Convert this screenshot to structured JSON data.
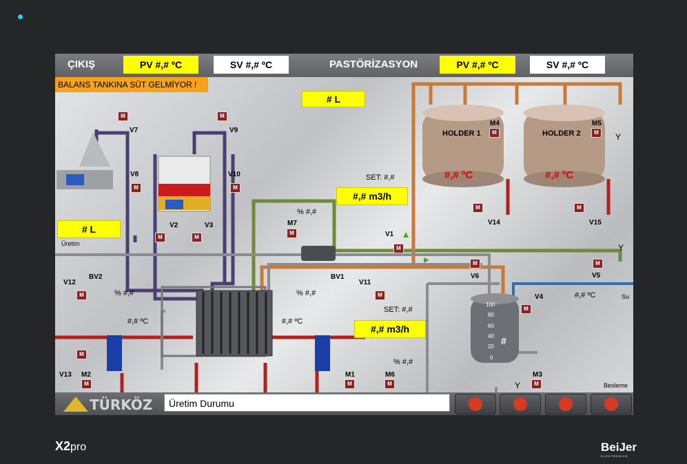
{
  "header": {
    "cikis_label": "ÇIKIŞ",
    "cikis_pv": "PV #,# ºC",
    "cikis_sv": "SV #,# ºC",
    "past_label": "PASTÖRİZASYON",
    "past_pv": "PV #,# ºC",
    "past_sv": "SV #,# ºC"
  },
  "alarm": "BALANS TANKINA SÜT GELMİYOR !",
  "level_top": "# L",
  "level_left": "# L",
  "uretim": "Üretim",
  "set_top": "SET: #,#",
  "flow_top": "#,# m3/h",
  "set_bottom": "SET: #,#",
  "flow_bottom": "#,# m3/h",
  "holder1": {
    "name": "HOLDER 1",
    "temp": "#,# ºC",
    "motor": "M4"
  },
  "holder2": {
    "name": "HOLDER 2",
    "temp": "#,# ºC",
    "motor": "M5"
  },
  "valves": {
    "v1": "V1",
    "v2": "V2",
    "v3": "V3",
    "v4": "V4",
    "v5": "V5",
    "v6": "V6",
    "v7": "V7",
    "v8": "V8",
    "v9": "V9",
    "v10": "V10",
    "v11": "V11",
    "v12": "V12",
    "v13": "V13",
    "v14": "V14",
    "v15": "V15",
    "bv1": "BV1",
    "bv2": "BV2"
  },
  "motors": {
    "m1": "M1",
    "m2": "M2",
    "m3": "M3",
    "m6": "M6",
    "m7": "M7",
    "m": "M"
  },
  "pct": {
    "m7": "% #,#",
    "bv2": "% #,#",
    "bv1": "% #,#",
    "m6": "% #,#"
  },
  "temps": {
    "left": "#,# ºC",
    "mid": "#,# ºC",
    "su": "#,# ºC"
  },
  "su": "Su",
  "besleme": "Besleme",
  "balance_tank": {
    "value": "#",
    "scale": [
      "100",
      "80",
      "60",
      "40",
      "20",
      "0"
    ]
  },
  "y": "Y",
  "brand": "TÜRKÖZ",
  "status": "Üretim Durumu",
  "device": {
    "model": "X2",
    "suffix": "pro",
    "vendor": "BeiJer",
    "vendor_sub": "ELECTRONICS"
  },
  "colors": {
    "accent": "#ffff00",
    "alarm": "#f7a21b",
    "motor": "#8b2020",
    "milk": "#c87a3a",
    "purple": "#4b3f72",
    "green": "#6f8b3a",
    "red": "#b32020",
    "water": "#2f6fb5"
  }
}
